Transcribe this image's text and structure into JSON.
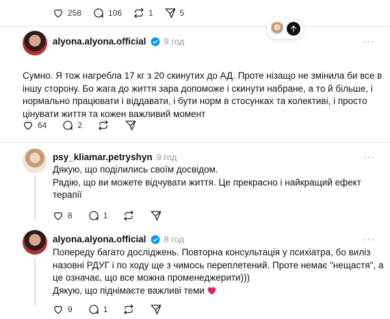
{
  "top_stats": {
    "likes": "258",
    "replies": "106",
    "reposts": "1",
    "shares": "5"
  },
  "post1": {
    "username": "alyona.alyona.official",
    "time": "9 год",
    "more": "···",
    "lines": [
      "Сумно. Я тож нагребла 17 кг з 20 скинутих до АД. Проте нізащо не змінила би все в",
      "іншу сторону. Бо жага до життя зара допоможе і скинути набране, а то й більше, і",
      "нормально працювати і віддавати, і бути норм в стосунках та колективі, і просто",
      "цінувати життя та кожен важливий момент"
    ],
    "likes": "64",
    "replies": "2"
  },
  "reply1": {
    "username": "psy_kliamar.petryshyn",
    "time": "9 год",
    "more": "···",
    "lines": [
      "Дякую, що поділились своїм досвідом.",
      "Радію, що ви можете відчувати життя. Це прекрасно і найкращий ефект",
      "терапії"
    ],
    "likes": "8",
    "replies": "1"
  },
  "reply2": {
    "username": "alyona.alyona.official",
    "time": "8 год",
    "more": "···",
    "lines": [
      "Попереду багато досліджень. Повторна консультація у психіатра, бо виліз",
      "назовні РДУГ і по ходу ще з чимось переплетений. Проте немає \"нещастя\", а",
      "це означає, що все можна променеджерити)))",
      "Дякую, що піднімаєте важливі теми"
    ],
    "likes": "9",
    "replies": "1"
  },
  "colors": {
    "verified": "#0095f6",
    "heart": "#e0245e",
    "divider": "#e3e3e3",
    "muted": "#9a9a9a"
  },
  "icons": [
    "heart-icon",
    "comment-icon",
    "repost-icon",
    "share-icon",
    "verified-icon",
    "arrow-up-icon"
  ]
}
